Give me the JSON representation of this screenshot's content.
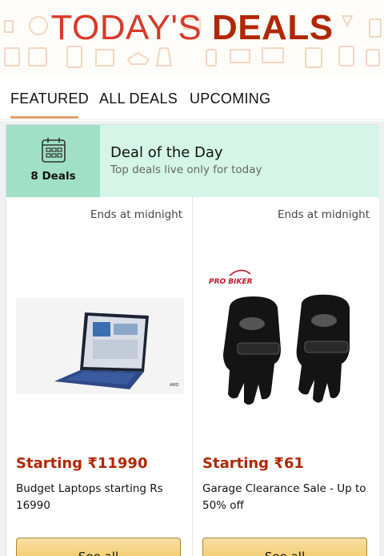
{
  "banner": {
    "title_part1": "TODAY'S",
    "title_part2": "DEALS"
  },
  "tabs": [
    {
      "label": "FEATURED",
      "active": true
    },
    {
      "label": "ALL DEALS",
      "active": false
    },
    {
      "label": "UPCOMING",
      "active": false
    }
  ],
  "deal_of_the_day": {
    "icon": "calendar-icon",
    "count": "8 Deals",
    "title": "Deal of the Day",
    "subtitle": "Top deals live only for today"
  },
  "deals": [
    {
      "ends": "Ends at midnight",
      "image": "laptop-image",
      "price": "Starting ₹11990",
      "description": "Budget Laptops starting Rs 16990",
      "button": "See all"
    },
    {
      "ends": "Ends at midnight",
      "image": "gloves-image",
      "brand": "PRO BIKER",
      "price": "Starting ₹61",
      "description": "Garage Clearance Sale - Up to 50% off",
      "button": "See all"
    }
  ],
  "colors": {
    "banner_title": "#d83a2a",
    "price": "#b12704",
    "dotd_bg": "#d4f5e8",
    "dotd_icon_bg": "#9fe0c7",
    "button": "#f0c14b"
  }
}
